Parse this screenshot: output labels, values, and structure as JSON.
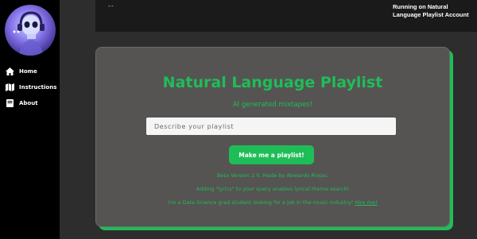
{
  "sidebar": {
    "items": [
      {
        "label": "Home",
        "icon": "home-icon"
      },
      {
        "label": "Instructions",
        "icon": "map-icon"
      },
      {
        "label": "About",
        "icon": "book-icon"
      }
    ]
  },
  "header": {
    "dash": "--",
    "account": "Running on Natural Language Playlist Account"
  },
  "main": {
    "title": "Natural Language Playlist",
    "subtitle": "AI generated mixtapes!",
    "search_placeholder": "Describe your playlist",
    "button_label": "Make me a playlist!",
    "version_line": "Beta Version 2.0. Made by Abelardo Riojas.",
    "lyrics_line": "Adding \"lyrics\" to your query enables lyrical theme search!",
    "hire_line": "I'm a Data Science grad student looking for a job in the music industry!",
    "hire_link": "Hire me!"
  },
  "colors": {
    "accent": "#1fbd57",
    "card": "#555453",
    "background": "#2d2d2d",
    "sidebar": "#000000"
  }
}
